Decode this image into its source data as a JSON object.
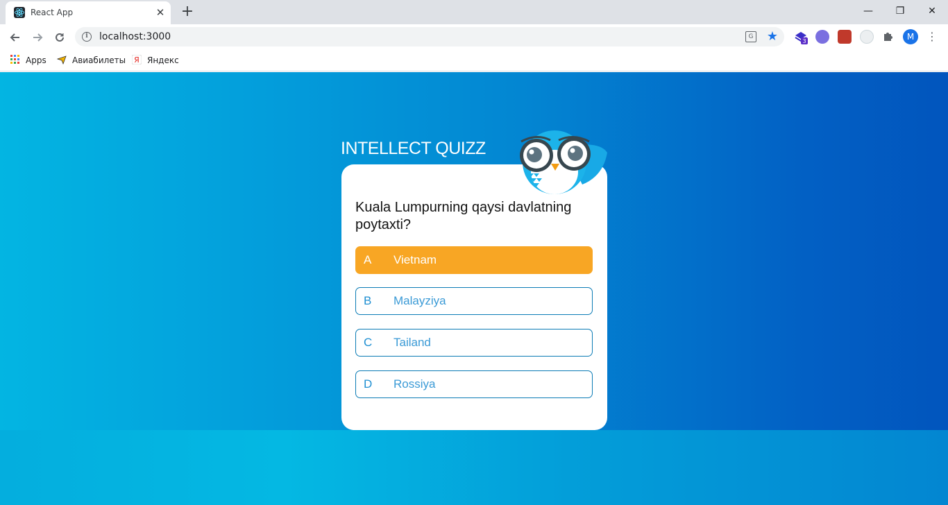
{
  "browser": {
    "tab_title": "React App",
    "tab_close": "✕",
    "new_tab": "+",
    "window_controls": {
      "minimize": "—",
      "restore": "❐",
      "close": "✕"
    },
    "url": "localhost:3000",
    "extension_badge": "3",
    "profile_initial": "M",
    "bookmarks": [
      {
        "label": "Apps",
        "icon": "apps-grid-icon"
      },
      {
        "label": "Авиабилеты",
        "icon": "airplane-icon"
      },
      {
        "label": "Яндекс",
        "icon": "yandex-icon"
      }
    ]
  },
  "quiz": {
    "title": "INTELLECT QUIZZ",
    "question": "Kuala Lumpurning qaysi davlatning poytaxti?",
    "options": [
      {
        "letter": "A",
        "text": "Vietnam",
        "selected": true
      },
      {
        "letter": "B",
        "text": "Malayziya",
        "selected": false
      },
      {
        "letter": "C",
        "text": "Tailand",
        "selected": false
      },
      {
        "letter": "D",
        "text": "Rossiya",
        "selected": false
      }
    ]
  },
  "colors": {
    "selected_option": "#f8a624",
    "option_border": "#0a7bb5",
    "background_left": "#03b5e2",
    "background_right": "#0155bd"
  }
}
